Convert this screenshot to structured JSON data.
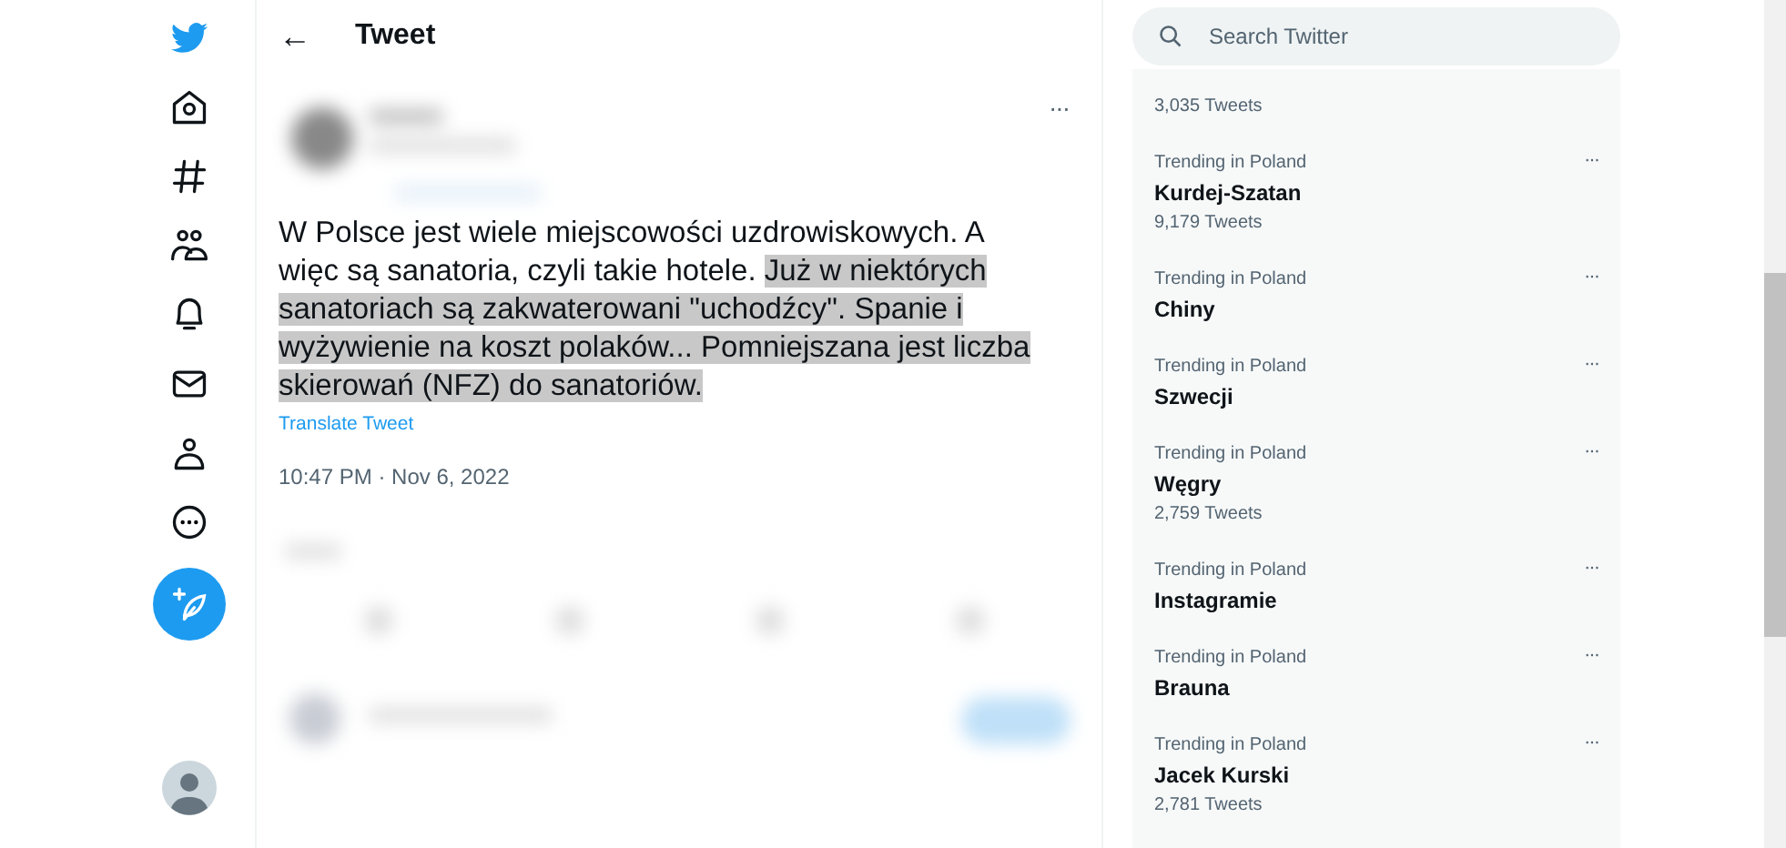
{
  "header": {
    "back": "←",
    "title": "Tweet"
  },
  "tweet": {
    "more": "···",
    "parts": [
      {
        "text": "W Polsce jest wiele miejscowości uzdrowiskowych. A więc są sanatoria, czyli takie hotele.  ",
        "selected": false
      },
      {
        "text": "Już w niektórych sanatoriach są zakwaterowani \"uchodźcy\". Spanie i wyżywienie na koszt polaków... Pomniejszana jest liczba skierowań (NFZ) do sanatoriów.",
        "selected": true
      }
    ],
    "translate": "Translate Tweet",
    "timestamp": "10:47 PM · Nov 6, 2022"
  },
  "search": {
    "placeholder": "Search Twitter"
  },
  "trends": [
    {
      "count": "3,035 Tweets"
    },
    {
      "category": "Trending in Poland",
      "name": "Kurdej-Szatan",
      "count": "9,179 Tweets"
    },
    {
      "category": "Trending in Poland",
      "name": "Chiny"
    },
    {
      "category": "Trending in Poland",
      "name": "Szwecji"
    },
    {
      "category": "Trending in Poland",
      "name": "Węgry",
      "count": "2,759 Tweets"
    },
    {
      "category": "Trending in Poland",
      "name": "Instagramie"
    },
    {
      "category": "Trending in Poland",
      "name": "Brauna"
    },
    {
      "category": "Trending in Poland",
      "name": "Jacek Kurski",
      "count": "2,781 Tweets"
    }
  ]
}
